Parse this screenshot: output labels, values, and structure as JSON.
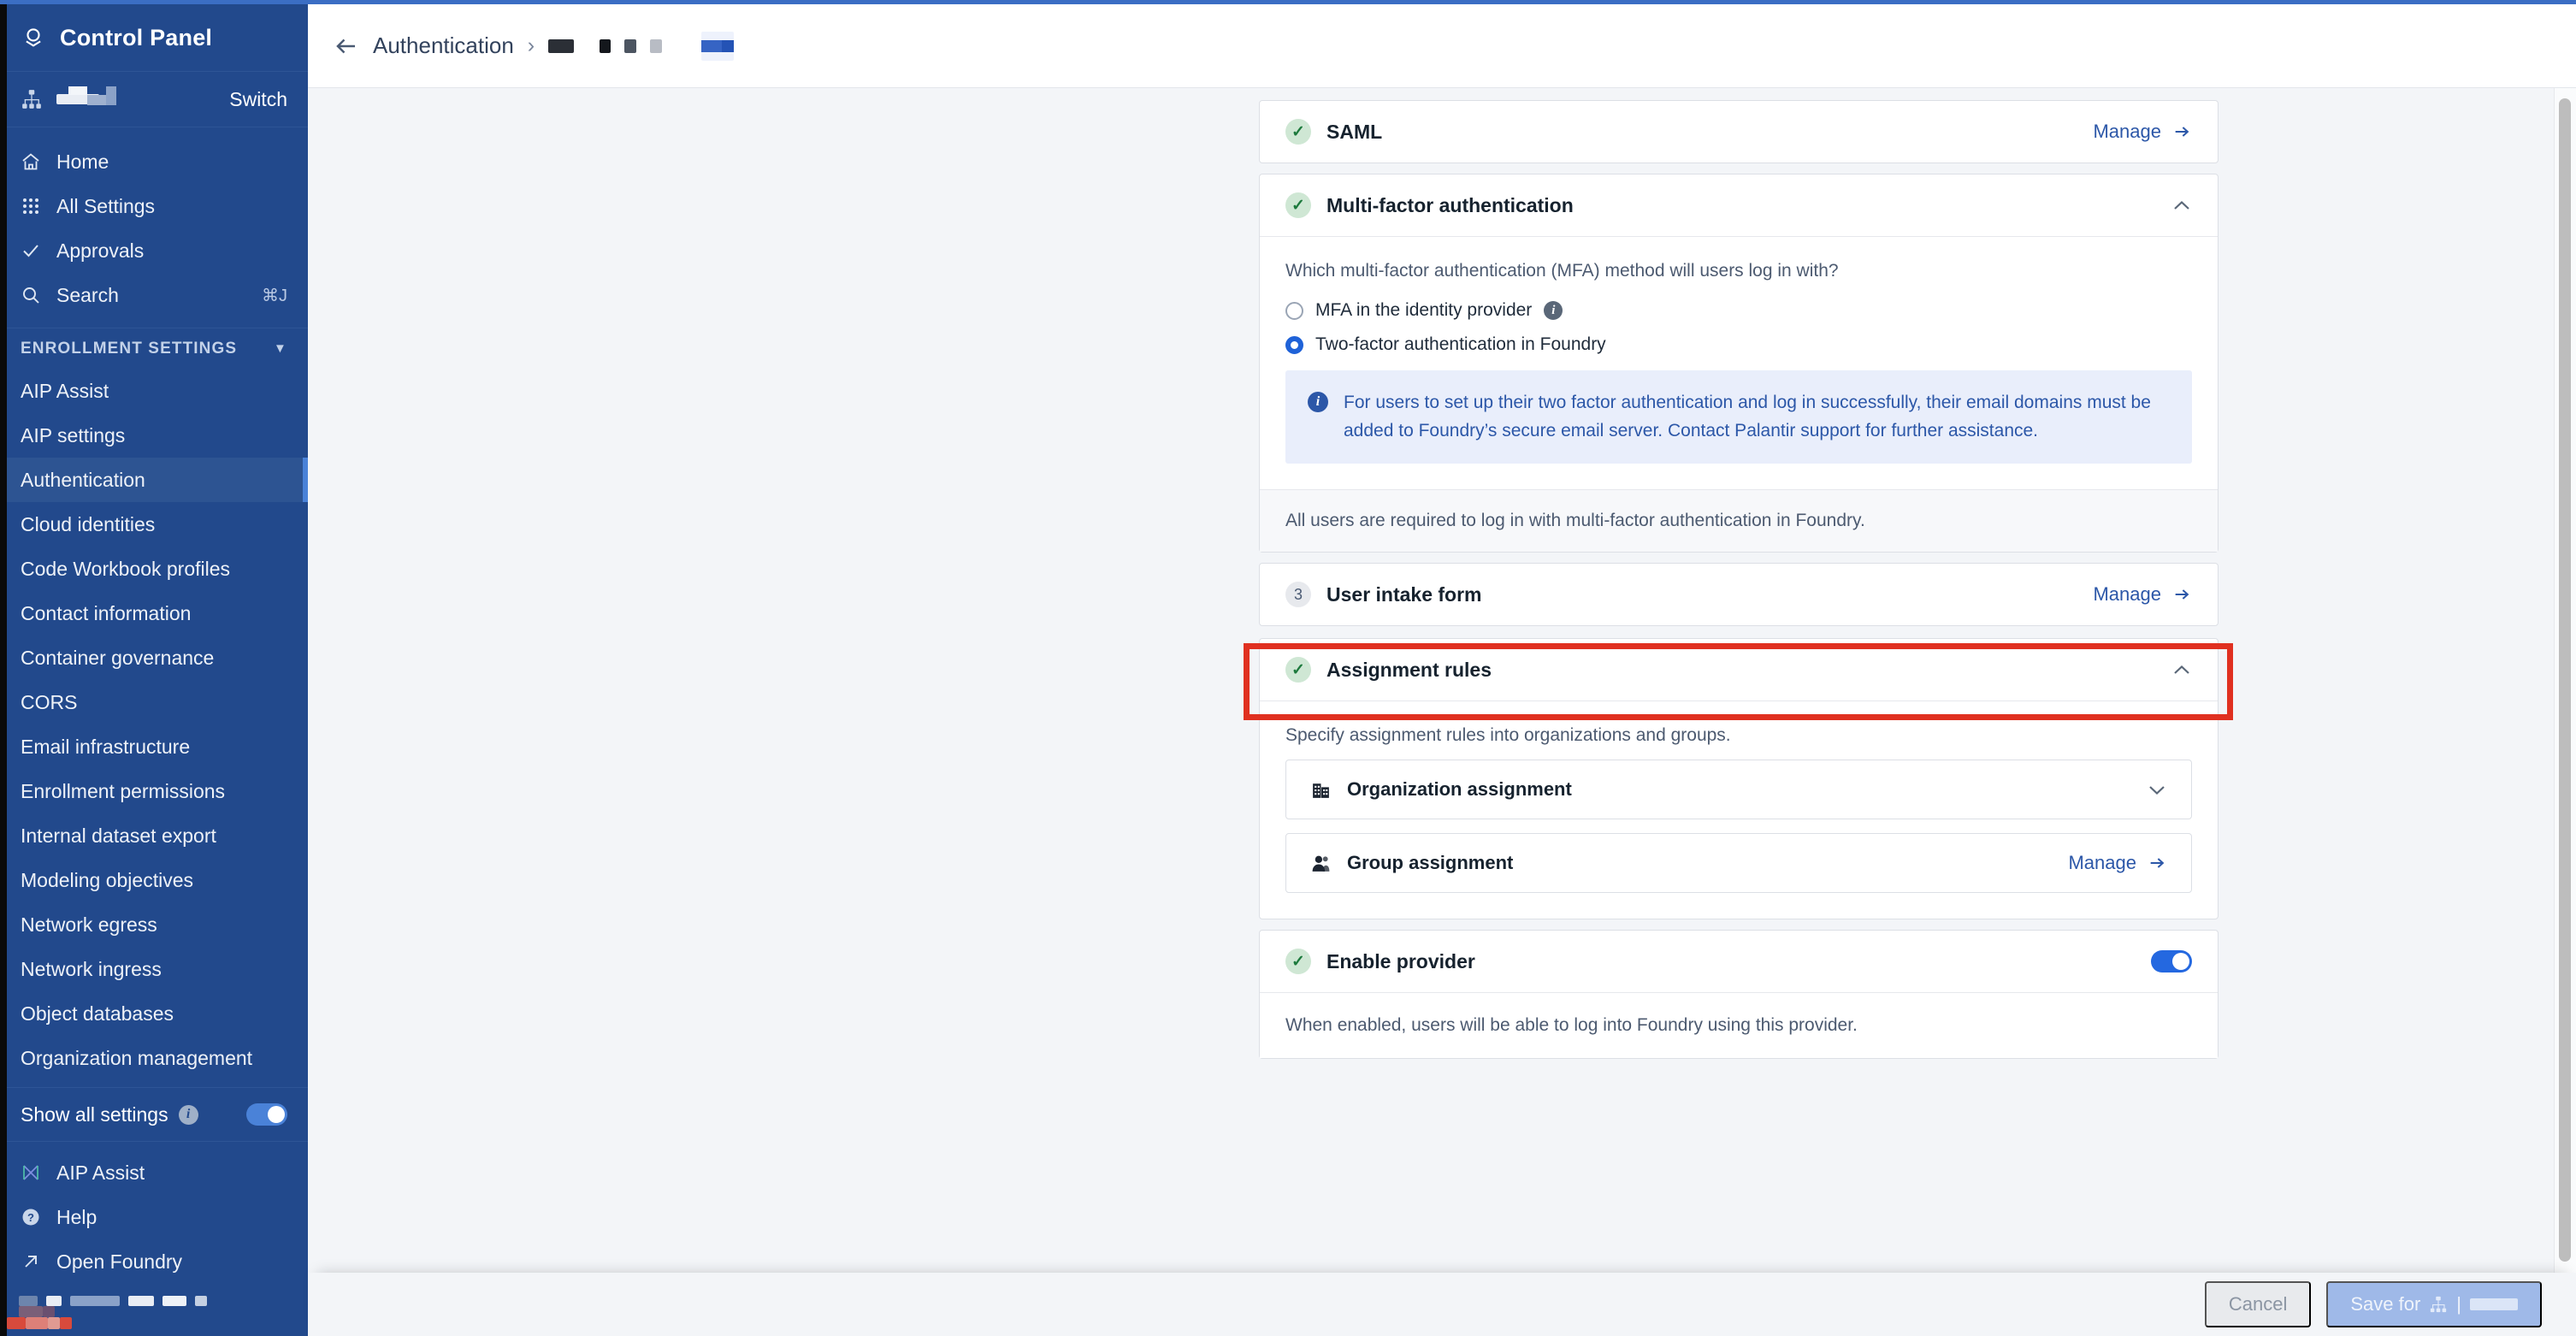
{
  "sidebar": {
    "brand": {
      "title": "Control Panel",
      "icon": "foundry-logo-icon"
    },
    "switch": {
      "icon": "org-hierarchy-icon",
      "redacted_org": "",
      "label": "Switch"
    },
    "nav": [
      {
        "label": "Home",
        "icon": "home-icon",
        "shortcut": ""
      },
      {
        "label": "All Settings",
        "icon": "grid-dots-icon",
        "shortcut": ""
      },
      {
        "label": "Approvals",
        "icon": "check-icon",
        "shortcut": ""
      },
      {
        "label": "Search",
        "icon": "search-icon",
        "shortcut": "⌘J"
      }
    ],
    "section": {
      "label": "ENROLLMENT SETTINGS",
      "caret": "chevron-down-icon"
    },
    "items": [
      {
        "label": "AIP Assist",
        "active": false
      },
      {
        "label": "AIP settings",
        "active": false
      },
      {
        "label": "Authentication",
        "active": true
      },
      {
        "label": "Cloud identities",
        "active": false
      },
      {
        "label": "Code Workbook profiles",
        "active": false
      },
      {
        "label": "Contact information",
        "active": false
      },
      {
        "label": "Container governance",
        "active": false
      },
      {
        "label": "CORS",
        "active": false
      },
      {
        "label": "Email infrastructure",
        "active": false
      },
      {
        "label": "Enrollment permissions",
        "active": false
      },
      {
        "label": "Internal dataset export",
        "active": false
      },
      {
        "label": "Modeling objectives",
        "active": false
      },
      {
        "label": "Network egress",
        "active": false
      },
      {
        "label": "Network ingress",
        "active": false
      },
      {
        "label": "Object databases",
        "active": false
      },
      {
        "label": "Organization management",
        "active": false
      }
    ],
    "show_all": {
      "label": "Show all settings",
      "info_icon": "info-icon",
      "toggle_on": true
    },
    "bottom": [
      {
        "label": "AIP Assist",
        "icon": "aip-assist-icon"
      },
      {
        "label": "Help",
        "icon": "help-circle-icon"
      },
      {
        "label": "Open Foundry",
        "icon": "external-link-icon"
      }
    ]
  },
  "topbar": {
    "back_icon": "back-arrow-icon",
    "title": "Authentication",
    "separator": "›",
    "redacted_crumbs": [
      "",
      "",
      ""
    ],
    "redacted_tag": ""
  },
  "cards": {
    "saml": {
      "title": "SAML",
      "status_icon": "check-badge-icon",
      "manage_label": "Manage",
      "manage_arrow": "arrow-right-icon"
    },
    "mfa": {
      "title": "Multi-factor authentication",
      "status_icon": "check-badge-icon",
      "collapse_icon": "chevron-up-icon",
      "question": "Which multi-factor authentication (MFA) method will users log in with?",
      "options": [
        {
          "label": "MFA in the identity provider",
          "selected": false,
          "info_icon": "info-icon"
        },
        {
          "label": "Two-factor authentication in Foundry",
          "selected": true,
          "info_icon": ""
        }
      ],
      "callout": {
        "icon": "info-icon",
        "text": "For users to set up their two factor authentication and log in successfully, their email domains must be added to Foundry’s secure email server. Contact Palantir support for further assistance."
      },
      "footer_text": "All users are required to log in with multi-factor authentication in Foundry."
    },
    "user_intake": {
      "step_number": "3",
      "title": "User intake form",
      "manage_label": "Manage",
      "manage_arrow": "arrow-right-icon",
      "highlighted": true
    },
    "assignment_rules": {
      "title": "Assignment rules",
      "status_icon": "check-badge-icon",
      "collapse_icon": "chevron-up-icon",
      "description": "Specify assignment rules into organizations and groups.",
      "rows": [
        {
          "label": "Organization assignment",
          "icon": "building-icon",
          "action": "chevron-down-icon",
          "manage_label": ""
        },
        {
          "label": "Group assignment",
          "icon": "user-group-icon",
          "action": "arrow-right-icon",
          "manage_label": "Manage"
        }
      ]
    },
    "enable_provider": {
      "title": "Enable provider",
      "status_icon": "check-badge-icon",
      "toggle_on": true,
      "description": "When enabled, users will be able to log into Foundry using this provider."
    }
  },
  "footer": {
    "cancel_label": "Cancel",
    "save_label": "Save for",
    "save_icon": "org-hierarchy-icon",
    "save_divider": "|",
    "save_redacted": ""
  },
  "colors": {
    "sidebar_bg": "#22498c",
    "accent_blue": "#2c57a8",
    "toggle_blue": "#2468e0",
    "highlight_red": "#e03020",
    "success_green": "#1d7a3d",
    "callout_bg": "#e9eefb"
  }
}
